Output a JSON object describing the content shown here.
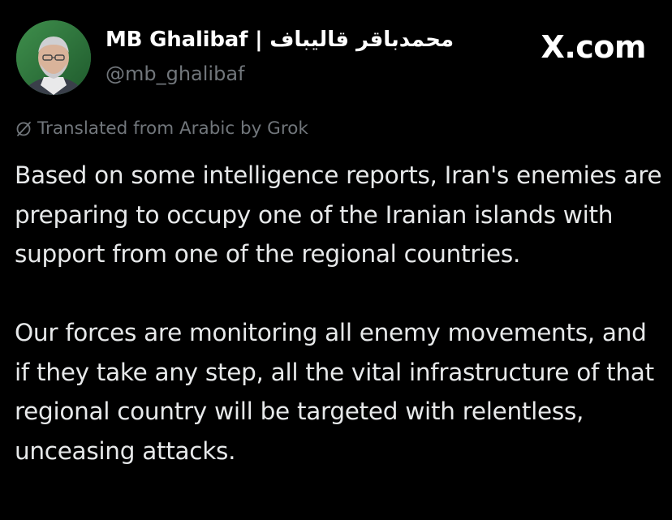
{
  "brand": {
    "label": "X.com"
  },
  "author": {
    "display_name": "MB Ghalibaf | محمدباقر قالیباف",
    "handle": "@mb_ghalibaf",
    "avatar_icon": "profile-photo"
  },
  "translation": {
    "label": "Translated from Arabic by Grok",
    "icon": "grok-icon"
  },
  "tweet": {
    "paragraphs": [
      "Based on some intelligence reports, Iran's enemies are preparing to occupy one of the Iranian islands with support from one of the regional countries.",
      "Our forces are monitoring all enemy movements, and if they take any step, all the vital infrastructure of that regional country will be targeted with relentless, unceasing attacks."
    ]
  },
  "colors": {
    "background": "#000000",
    "primary_text": "#e7e9ea",
    "secondary_text": "#71767b"
  }
}
